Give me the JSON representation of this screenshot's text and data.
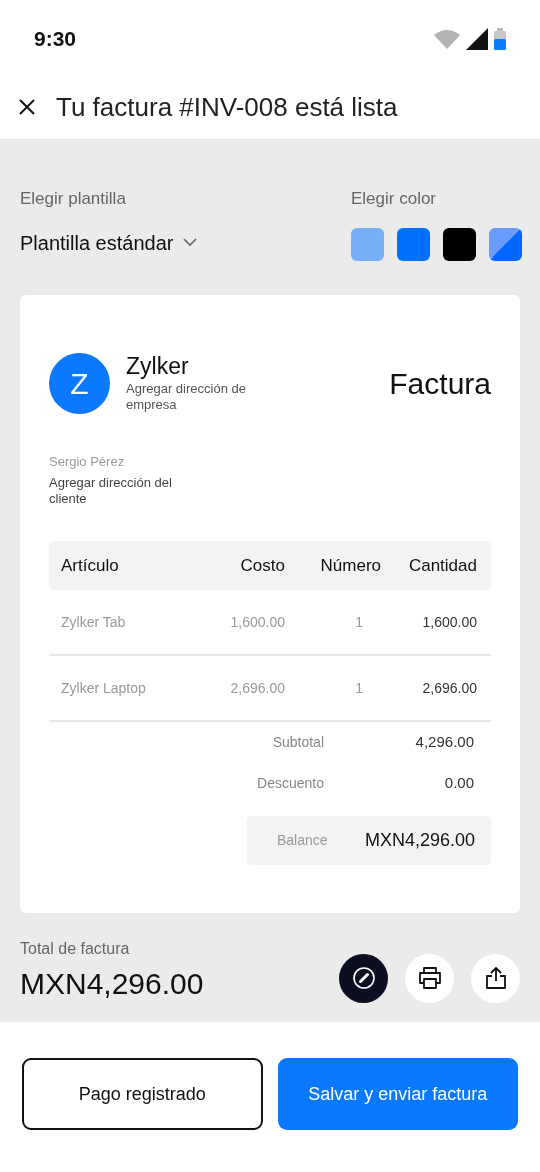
{
  "status_bar": {
    "time": "9:30"
  },
  "header": {
    "title": "Tu factura #INV-008 está lista"
  },
  "template": {
    "label": "Elegir plantilla",
    "value": "Plantilla estándar"
  },
  "colors": {
    "label": "Elegir color",
    "swatches": [
      {
        "kind": "solid",
        "color": "#79aff7"
      },
      {
        "kind": "solid",
        "color": "#0070ff"
      },
      {
        "kind": "solid",
        "color": "#000000"
      },
      {
        "kind": "gradient",
        "color": "#0066ff"
      }
    ]
  },
  "invoice": {
    "logo_letter": "Z",
    "company": "Zylker",
    "company_address": "Agregar dirección de empresa",
    "doc_title": "Factura",
    "customer": "Sergio Pérez",
    "customer_address": "Agregar dirección del cliente",
    "table": {
      "columns": [
        "Artículo",
        "Costo",
        "Número",
        "Cantidad"
      ],
      "rows": [
        [
          "Zylker Tab",
          "1,600.00",
          "1",
          "1,600.00"
        ],
        [
          "Zylker Laptop",
          "2,696.00",
          "1",
          "2,696.00"
        ]
      ]
    },
    "subtotal": {
      "label": "Subtotal",
      "value": "4,296.00"
    },
    "discount": {
      "label": "Descuento",
      "value": "0.00"
    },
    "balance": {
      "label": "Balance",
      "value": "MXN4,296.00"
    }
  },
  "total": {
    "label": "Total de factura",
    "value": "MXN4,296.00"
  },
  "buttons": {
    "secondary": "Pago registrado",
    "primary": "Salvar y enviar factura"
  }
}
